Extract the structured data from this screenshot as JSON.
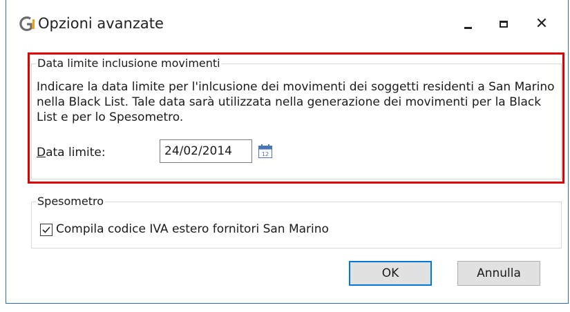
{
  "window": {
    "title": "Opzioni avanzate"
  },
  "group_inclusione": {
    "legend": "Data limite inclusione movimenti",
    "description": "Indicare la data limite per l'inlcusione dei movimenti dei soggetti residenti a San Marino nella Black List. Tale data sarà utilizzata nella generazione dei movimenti per la Black List e per lo Spesometro.",
    "date_label_first": "D",
    "date_label_rest": "ata limite:",
    "date_value": "24/02/2014"
  },
  "group_spesometro": {
    "legend": "Spesometro",
    "checkbox_label": "Compila codice IVA estero fornitori San Marino",
    "checked": true
  },
  "buttons": {
    "ok_label": "OK",
    "cancel_label": "Annulla"
  },
  "colors": {
    "highlight": "#e00000",
    "window_border": "#2b6cb0",
    "logo_gray": "#6b6b6b",
    "logo_orange": "#f0a010"
  },
  "icons": {
    "app": "gi-logo-icon",
    "minimize": "minimize-icon",
    "maximize": "maximize-icon",
    "close": "close-icon",
    "calendar": "calendar-icon",
    "checkmark": "checkmark-icon"
  }
}
